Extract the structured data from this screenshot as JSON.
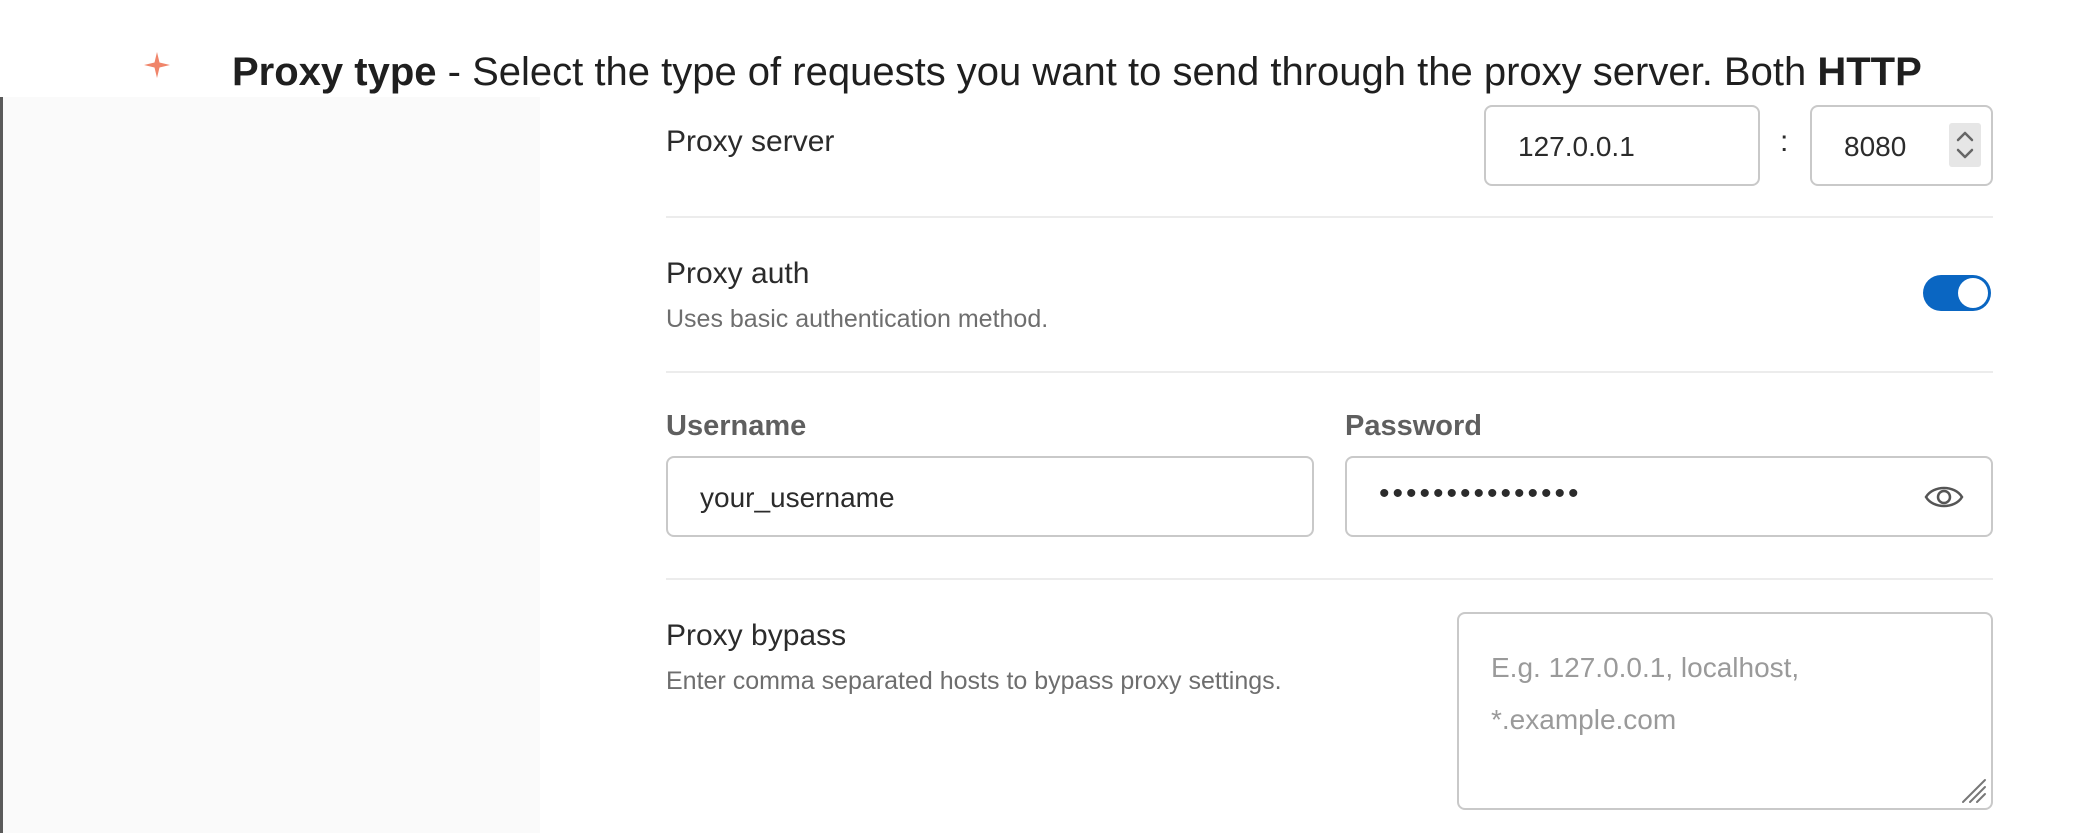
{
  "doc": {
    "bullet_icon": "sparkle-icon",
    "term": "Proxy type",
    "text": " - Select the type of requests you want to send through the proxy server. Both ",
    "emphasis": "HTTP"
  },
  "proxy_server": {
    "label": "Proxy server",
    "host": "127.0.0.1",
    "separator": ":",
    "port": "8080"
  },
  "proxy_auth": {
    "label": "Proxy auth",
    "description": "Uses basic authentication method.",
    "enabled": true
  },
  "credentials": {
    "username_label": "Username",
    "username_value": "your_username",
    "password_label": "Password",
    "password_masked": "•••••••••••••••"
  },
  "proxy_bypass": {
    "label": "Proxy bypass",
    "description": "Enter comma separated hosts to bypass proxy settings.",
    "placeholder": "E.g. 127.0.0.1, localhost, *.example.com"
  },
  "colors": {
    "accent": "#0a66c2",
    "bullet": "#f0856a"
  }
}
